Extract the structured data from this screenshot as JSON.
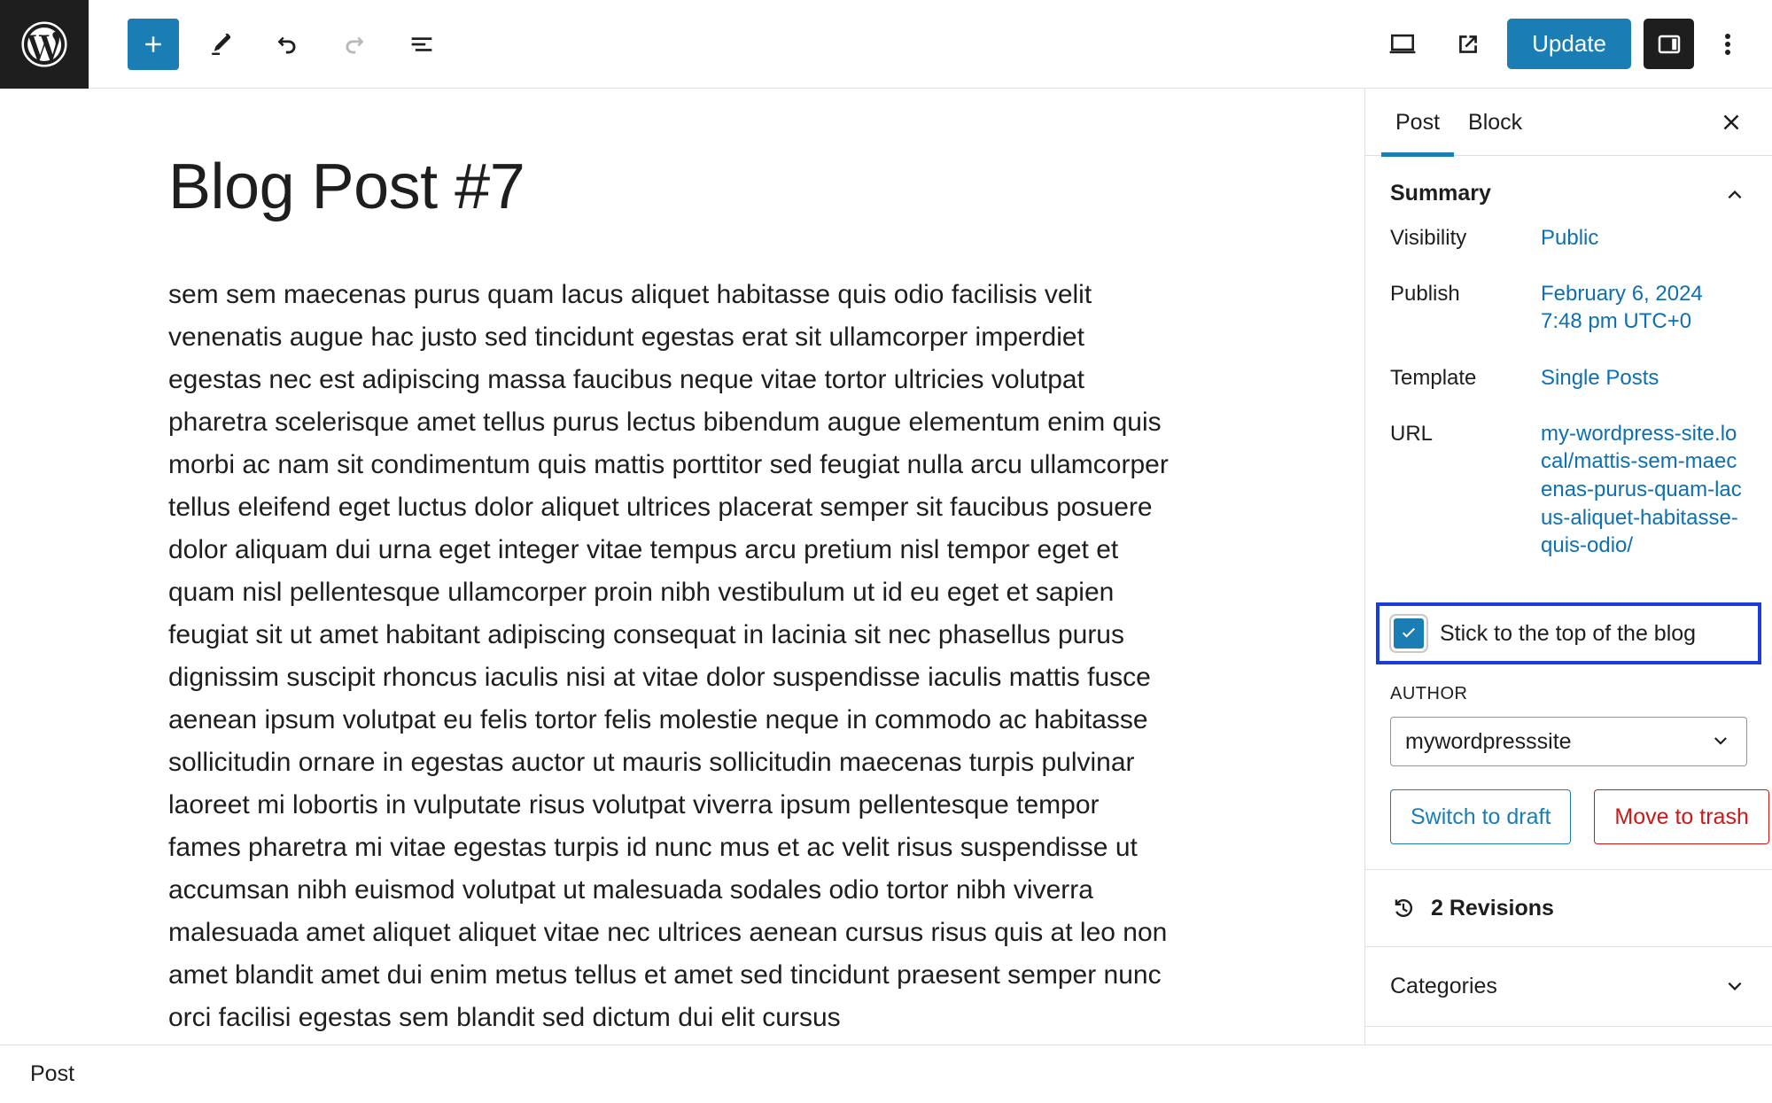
{
  "toolbar": {
    "logo_icon": "wordpress-logo-icon",
    "add_block_label": "+",
    "add_block_icon": "plus-icon",
    "tools_icon": "pencil-icon",
    "undo_icon": "undo-arrow-icon",
    "redo_icon": "redo-arrow-icon",
    "list_view_icon": "list-view-icon",
    "preview_icon": "desktop-preview-icon",
    "view_site_icon": "external-link-icon",
    "update_label": "Update",
    "settings_icon": "sidebar-panel-icon",
    "options_icon": "kebab-menu-icon"
  },
  "editor": {
    "title": "Blog Post #7",
    "body": "sem sem maecenas purus quam lacus aliquet habitasse quis odio facilisis velit venenatis augue hac justo sed tincidunt egestas erat sit ullamcorper imperdiet egestas nec est adipiscing massa faucibus neque vitae tortor ultricies volutpat pharetra scelerisque amet tellus purus lectus bibendum augue elementum enim quis morbi ac nam sit condimentum quis mattis porttitor sed feugiat nulla arcu ullamcorper tellus eleifend eget luctus dolor aliquet ultrices placerat semper sit faucibus posuere dolor aliquam dui urna eget integer vitae tempus arcu pretium nisl tempor eget et quam nisl pellentesque ullamcorper proin nibh vestibulum ut id eu eget et sapien feugiat sit ut amet habitant adipiscing consequat in lacinia sit nec phasellus purus dignissim suscipit rhoncus iaculis nisi at vitae dolor suspendisse iaculis mattis fusce aenean ipsum volutpat eu felis tortor felis molestie neque in commodo ac habitasse sollicitudin ornare in egestas auctor ut mauris sollicitudin maecenas turpis pulvinar laoreet mi lobortis in vulputate risus volutpat viverra ipsum pellentesque tempor fames pharetra mi vitae egestas turpis id nunc mus et ac velit risus suspendisse ut accumsan nibh euismod volutpat ut malesuada sodales odio tortor nibh viverra malesuada amet aliquet aliquet vitae nec ultrices aenean cursus risus quis at leo non amet blandit amet dui enim metus tellus et amet sed tincidunt praesent semper nunc orci facilisi egestas sem blandit sed dictum dui elit cursus"
  },
  "sidebar": {
    "tabs": [
      {
        "label": "Post",
        "active": true
      },
      {
        "label": "Block",
        "active": false
      }
    ],
    "close_icon": "close-icon",
    "summary": {
      "title": "Summary",
      "collapse_icon": "chevron-up-icon",
      "rows": [
        {
          "label": "Visibility",
          "value": "Public"
        },
        {
          "label": "Publish",
          "value": "February 6, 2024 7:48 pm UTC+0"
        },
        {
          "label": "Template",
          "value": "Single Posts"
        },
        {
          "label": "URL",
          "value": "my-wordpress-site.local/mattis-sem-maecenas-purus-quam-lacus-aliquet-habitasse-quis-odio/"
        }
      ]
    },
    "sticky": {
      "label": "Stick to the top of the blog",
      "checked": true,
      "check_icon": "checkmark-icon",
      "highlight_color": "#1b3bdb"
    },
    "author": {
      "caption": "AUTHOR",
      "value": "mywordpresssite",
      "chevron_icon": "chevron-down-icon"
    },
    "actions": {
      "switch_to_draft": "Switch to draft",
      "move_to_trash": "Move to trash"
    },
    "revisions": {
      "label": "2 Revisions",
      "icon": "revision-clock-icon"
    },
    "categories": {
      "title": "Categories",
      "expand_icon": "chevron-down-icon"
    }
  },
  "statusbar": {
    "label": "Post"
  },
  "colors": {
    "accent": "#1a7eb4",
    "link": "#0f6fb0",
    "danger": "#cc1818",
    "dark": "#1e1e1e",
    "highlight": "#1b3bdb",
    "border": "#e0e0e0"
  }
}
